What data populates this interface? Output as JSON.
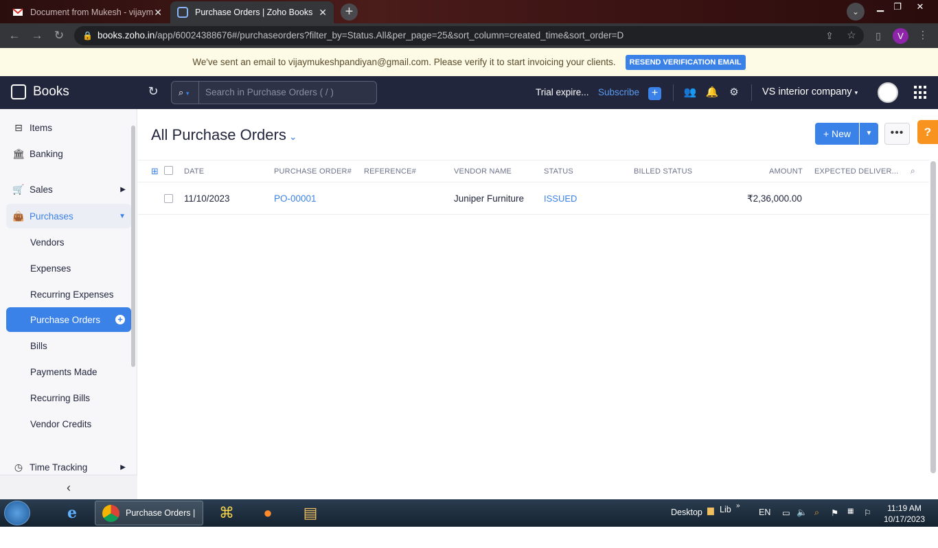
{
  "browser": {
    "tabs": [
      {
        "title": "Document from Mukesh - vijaym",
        "active": false
      },
      {
        "title": "Purchase Orders | Zoho Books",
        "active": true
      }
    ],
    "url_host": "books.zoho.in",
    "url_path": "/app/60024388676#/purchaseorders?filter_by=Status.All&per_page=25&sort_column=created_time&sort_order=D",
    "profile_initial": "V"
  },
  "banner": {
    "message": "We've sent an email to vijaymukeshpandiyan@gmail.com. Please verify it to start invoicing your clients.",
    "button": "RESEND VERIFICATION EMAIL"
  },
  "header": {
    "app_name": "Books",
    "search_placeholder": "Search in Purchase Orders ( / )",
    "trial": "Trial expire...",
    "subscribe": "Subscribe",
    "org": "VS interior company"
  },
  "sidebar": {
    "items": [
      {
        "label": "Items",
        "icon": "basket-icon"
      },
      {
        "label": "Banking",
        "icon": "bank-icon"
      },
      {
        "label": "Sales",
        "icon": "cart-icon"
      },
      {
        "label": "Purchases",
        "icon": "bag-icon"
      },
      {
        "label": "Vendors"
      },
      {
        "label": "Expenses"
      },
      {
        "label": "Recurring Expenses"
      },
      {
        "label": "Purchase Orders"
      },
      {
        "label": "Bills"
      },
      {
        "label": "Payments Made"
      },
      {
        "label": "Recurring Bills"
      },
      {
        "label": "Vendor Credits"
      },
      {
        "label": "Time Tracking",
        "icon": "clock-icon"
      }
    ]
  },
  "main": {
    "title": "All Purchase Orders",
    "new_label": "+ New",
    "columns": [
      "DATE",
      "PURCHASE ORDER#",
      "REFERENCE#",
      "VENDOR NAME",
      "STATUS",
      "BILLED STATUS",
      "AMOUNT",
      "EXPECTED DELIVER..."
    ],
    "rows": [
      {
        "date": "11/10/2023",
        "po": "PO-00001",
        "reference": "",
        "vendor": "Juniper Furniture",
        "status": "ISSUED",
        "billed": "",
        "amount": "₹2,36,000.00",
        "expected": ""
      }
    ]
  },
  "taskbar": {
    "chrome_label": "Purchase Orders | ...",
    "desktop": "Desktop",
    "lib": "Lib",
    "lang": "EN",
    "time": "11:19 AM",
    "date": "10/17/2023"
  },
  "colors": {
    "accent": "#3b82e8",
    "header_bg": "#21263c",
    "help": "#f7931e"
  }
}
